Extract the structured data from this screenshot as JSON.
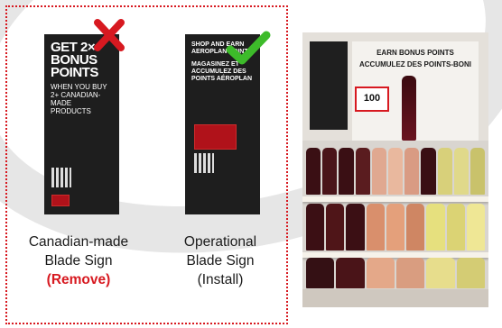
{
  "signs": {
    "left": {
      "heading": "GET 2× BONUS POINTS",
      "sub": "WHEN YOU BUY 2+ CANADIAN-MADE PRODUCTS",
      "caption_line1": "Canadian-made",
      "caption_line2": "Blade Sign",
      "caption_action": "(Remove)",
      "status": "remove"
    },
    "right": {
      "heading": "SHOP AND EARN AEROPLAN POINTS",
      "sub": "MAGASINEZ ET ACCUMULEZ DES POINTS AÉROPLAN",
      "caption_line1": "Operational",
      "caption_line2": "Blade Sign",
      "caption_action": "(Install)",
      "status": "install"
    }
  },
  "photo": {
    "poster_title": "EARN BONUS POINTS",
    "poster_title_fr": "ACCUMULEZ DES POINTS-BONI",
    "badge": "100"
  },
  "colors": {
    "accent_red": "#d71920",
    "check_green": "#3dbb2a"
  }
}
